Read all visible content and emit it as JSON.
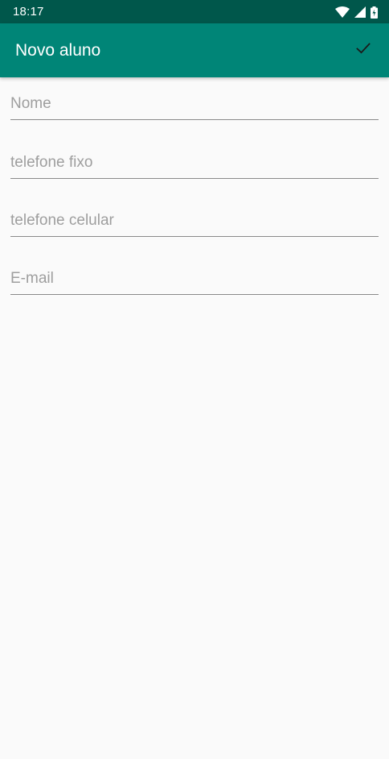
{
  "status_bar": {
    "time": "18:17",
    "icons": [
      "wifi-icon",
      "cell-signal-icon",
      "battery-charging-icon"
    ]
  },
  "app_bar": {
    "title": "Novo aluno",
    "action_icon": "check-icon"
  },
  "form": {
    "fields": [
      {
        "placeholder": "Nome",
        "value": ""
      },
      {
        "placeholder": "telefone fixo",
        "value": ""
      },
      {
        "placeholder": "telefone celular",
        "value": ""
      },
      {
        "placeholder": "E-mail",
        "value": ""
      }
    ]
  },
  "colors": {
    "status_bar": "#00574b",
    "app_bar": "#008577",
    "background": "#fafafa"
  }
}
